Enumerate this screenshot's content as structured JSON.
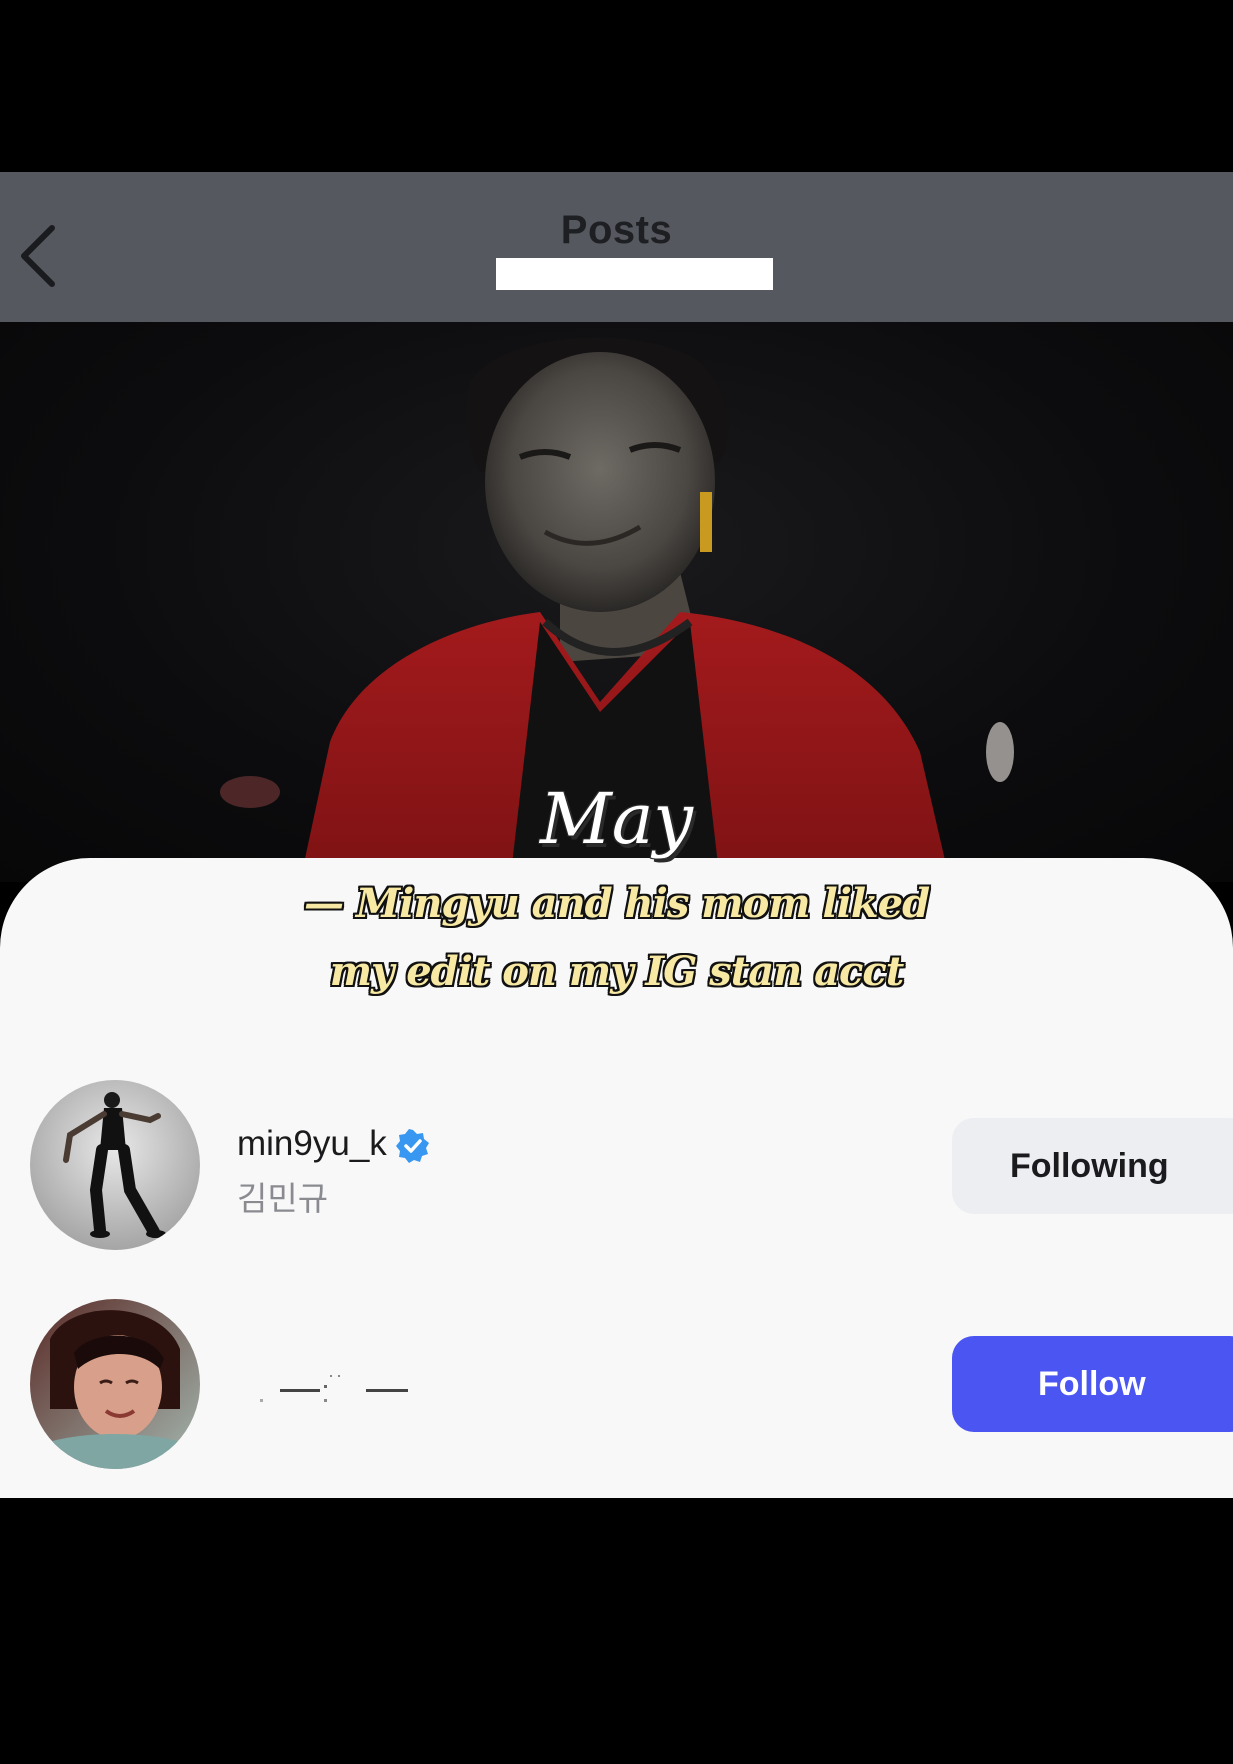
{
  "header": {
    "title": "Posts",
    "back_icon": "chevron-left-icon"
  },
  "overlay": {
    "month": "May",
    "caption_line_1": "— Mingyu and his mom liked",
    "caption_line_2": "my edit on my IG stan acct"
  },
  "likes": [
    {
      "username": "min9yu_k",
      "verified": true,
      "full_name": "김민규",
      "button_label": "Following"
    },
    {
      "username": "",
      "verified": false,
      "full_name": "",
      "button_label": "Follow"
    }
  ],
  "colors": {
    "header_bg": "#55585e",
    "follow_button": "#4a55f2",
    "following_button": "#eceef1",
    "verified_badge": "#3897f0",
    "caption_yellow": "#f7e9a3"
  }
}
